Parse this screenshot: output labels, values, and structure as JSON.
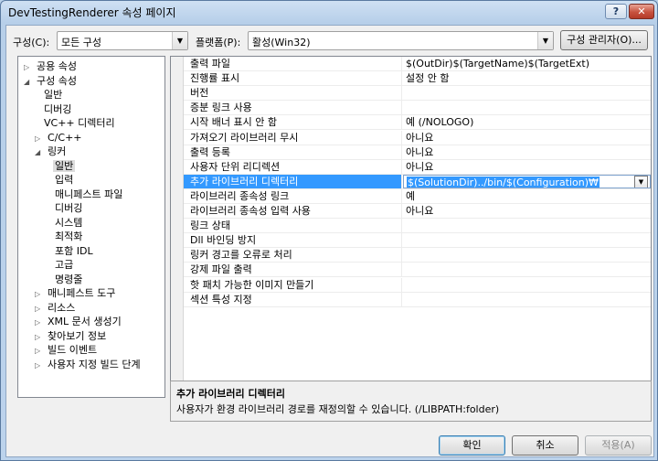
{
  "window": {
    "title": "DevTestingRenderer 속성 페이지",
    "help": "?",
    "close": "✕"
  },
  "toolbar": {
    "config_label": "구성(C):",
    "config_value": "모든 구성",
    "platform_label": "플랫폼(P):",
    "platform_value": "활성(Win32)",
    "config_manager": "구성 관리자(O)..."
  },
  "icons": {
    "collapsed": "▷",
    "expanded": "◢",
    "dropdown": "▼"
  },
  "tree": [
    {
      "label": "공용 속성",
      "exp": "▷"
    },
    {
      "label": "구성 속성",
      "exp": "◢"
    },
    {
      "label": "일반",
      "exp": ""
    },
    {
      "label": "디버깅",
      "exp": ""
    },
    {
      "label": "VC++ 디렉터리",
      "exp": ""
    },
    {
      "label": "C/C++",
      "exp": "▷"
    },
    {
      "label": "링커",
      "exp": "◢"
    },
    {
      "label": "일반",
      "exp": "",
      "selected": true
    },
    {
      "label": "입력",
      "exp": ""
    },
    {
      "label": "매니페스트 파일",
      "exp": ""
    },
    {
      "label": "디버깅",
      "exp": ""
    },
    {
      "label": "시스템",
      "exp": ""
    },
    {
      "label": "최적화",
      "exp": ""
    },
    {
      "label": "포함 IDL",
      "exp": ""
    },
    {
      "label": "고급",
      "exp": ""
    },
    {
      "label": "명령줄",
      "exp": ""
    },
    {
      "label": "매니페스트 도구",
      "exp": "▷"
    },
    {
      "label": "리소스",
      "exp": "▷"
    },
    {
      "label": "XML 문서 생성기",
      "exp": "▷"
    },
    {
      "label": "찾아보기 정보",
      "exp": "▷"
    },
    {
      "label": "빌드 이벤트",
      "exp": "▷"
    },
    {
      "label": "사용자 지정 빌드 단계",
      "exp": "▷"
    }
  ],
  "properties": [
    {
      "name": "출력 파일",
      "value": "$(OutDir)$(TargetName)$(TargetExt)"
    },
    {
      "name": "진행률 표시",
      "value": "설정 안 함"
    },
    {
      "name": "버전",
      "value": ""
    },
    {
      "name": "증분 링크 사용",
      "value": ""
    },
    {
      "name": "시작 배너 표시 안 함",
      "value": "예 (/NOLOGO)"
    },
    {
      "name": "가져오기 라이브러리 무시",
      "value": "아니요"
    },
    {
      "name": "출력 등록",
      "value": "아니요"
    },
    {
      "name": "사용자 단위 리디렉션",
      "value": "아니요"
    },
    {
      "name": "추가 라이브러리 디렉터리",
      "value": "$(SolutionDir)../bin/$(Configuration)₩",
      "selected": true
    },
    {
      "name": "라이브러리 종속성 링크",
      "value": "예"
    },
    {
      "name": "라이브러리 종속성 입력 사용",
      "value": "아니요"
    },
    {
      "name": "링크 상태",
      "value": ""
    },
    {
      "name": "Dll 바인딩 방지",
      "value": ""
    },
    {
      "name": "링커 경고를 오류로 처리",
      "value": ""
    },
    {
      "name": "강제 파일 출력",
      "value": ""
    },
    {
      "name": "핫 패치 가능한 이미지 만들기",
      "value": ""
    },
    {
      "name": "섹션 특성 지정",
      "value": ""
    }
  ],
  "description": {
    "title": "추가 라이브러리 디렉터리",
    "text": "사용자가 환경 라이브러리 경로를 재정의할 수 있습니다. (/LIBPATH:folder)"
  },
  "buttons": {
    "ok": "확인",
    "cancel": "취소",
    "apply": "적용(A)"
  }
}
